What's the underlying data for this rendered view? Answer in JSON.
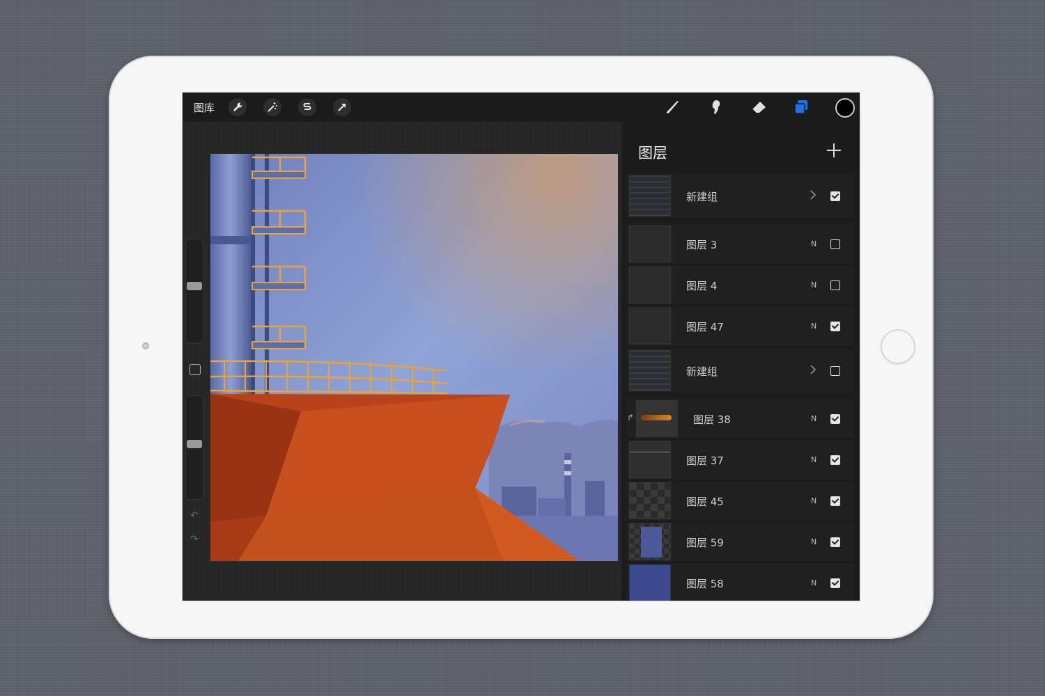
{
  "toolbar": {
    "gallery_label": "图库",
    "left_tools": [
      "wrench-icon",
      "magic-wand-icon",
      "selection-icon",
      "transform-arrow-icon"
    ],
    "right_tools": [
      "brush-icon",
      "smudge-icon",
      "eraser-icon",
      "layers-icon"
    ],
    "active_tool": "layers-icon",
    "current_color": "#000000",
    "accent_color": "#1a73e8"
  },
  "sidebar": {
    "brush_size_level": 0.18,
    "opacity_level": 0.45
  },
  "layers_panel": {
    "title": "图层",
    "layers": [
      {
        "name": "新建组",
        "kind": "group",
        "visible": true
      },
      {
        "name": "图层 3",
        "mode": "N",
        "visible": false
      },
      {
        "name": "图层 4",
        "mode": "N",
        "visible": false
      },
      {
        "name": "图层 47",
        "mode": "N",
        "visible": true
      },
      {
        "name": "新建组",
        "kind": "group",
        "visible": false
      },
      {
        "name": "图层 38",
        "mode": "N",
        "visible": true,
        "clipped": true
      },
      {
        "name": "图层 37",
        "mode": "N",
        "visible": true
      },
      {
        "name": "图层 45",
        "mode": "N",
        "visible": true
      },
      {
        "name": "图层 59",
        "mode": "N",
        "visible": true
      },
      {
        "name": "图层 58",
        "mode": "N",
        "visible": true
      }
    ]
  },
  "artwork_colors": {
    "sky": "#7f92c8",
    "ship_hull": "#c24a1a",
    "railing": "#e8a43a",
    "tower": "#6f7fb8"
  }
}
